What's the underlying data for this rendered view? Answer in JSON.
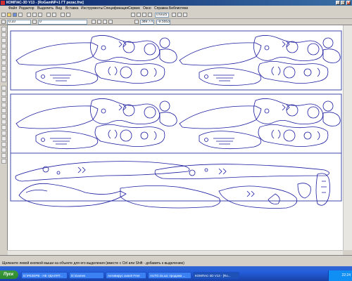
{
  "window": {
    "title": "КОМПАС-3D V13 - [RoGamNP+1 ГТ pezac.frw]",
    "controls": [
      "_",
      "□",
      "×"
    ]
  },
  "menu": [
    "Файл",
    "Редактор",
    "Выделить",
    "Вид",
    "Вставка",
    "Инструменты",
    "Спецификация",
    "Сервис",
    "Окно",
    "Справка",
    "Библиотеки"
  ],
  "toolbar": {
    "scale_value": "0.6025",
    "coord_x": "389.770",
    "coord_y": "-9.5553",
    "step_value": "0.10",
    "layer_value": "0"
  },
  "status": {
    "hint": "Щелкните левой кнопкой мыши на объекте для его выделения (вместе с Ctrl или Shift - добавить к выделению)"
  },
  "taskbar": {
    "start_label": "Пуск",
    "tasks": [
      {
        "label": "D:\\РЕЗЕРВ - НЕ УДАЛЯТ...",
        "active": false
      },
      {
        "label": "D:\\Games",
        "active": false
      },
      {
        "label": "Антивирус avast! Free",
        "active": false
      },
      {
        "label": "AUTO.ria.ua: продажа ...",
        "active": false
      },
      {
        "label": "КОМПАС-3D V13 - [Ro...",
        "active": true
      }
    ],
    "clock": "22:24"
  },
  "colors": {
    "drawing_stroke": "#1a1aa0",
    "frame_stroke": "#3b4aa8"
  }
}
